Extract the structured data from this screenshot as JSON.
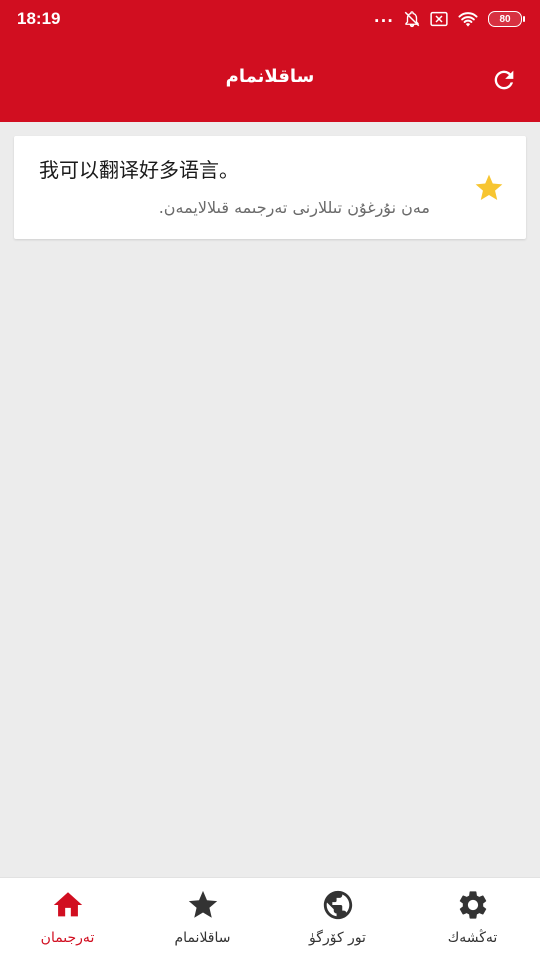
{
  "status_bar": {
    "time": "18:19",
    "dots": "...",
    "battery": "80",
    "icons": [
      "bell-off-icon",
      "notification-x-icon",
      "wifi-icon",
      "battery-icon"
    ]
  },
  "app_bar": {
    "title": "ساقلانمام",
    "refresh_icon": "refresh-icon"
  },
  "favorites": [
    {
      "source": "我可以翻译好多语言。",
      "translation": "مەن نۇرغۇن تىللارنى تەرجىمە قىلالايمەن.",
      "starred": true
    }
  ],
  "bottom_nav": {
    "items": [
      {
        "label": "تەرجىمان",
        "icon": "home-icon",
        "active": true
      },
      {
        "label": "ساقلانمام",
        "icon": "star-icon",
        "active": false
      },
      {
        "label": "تور كۆرگۈ",
        "icon": "globe-icon",
        "active": false
      },
      {
        "label": "تەڭشەك",
        "icon": "gear-icon",
        "active": false
      }
    ]
  },
  "colors": {
    "primary": "#d10e20",
    "star": "#f7c531",
    "background": "#ececec",
    "icon_dark": "#333333"
  }
}
